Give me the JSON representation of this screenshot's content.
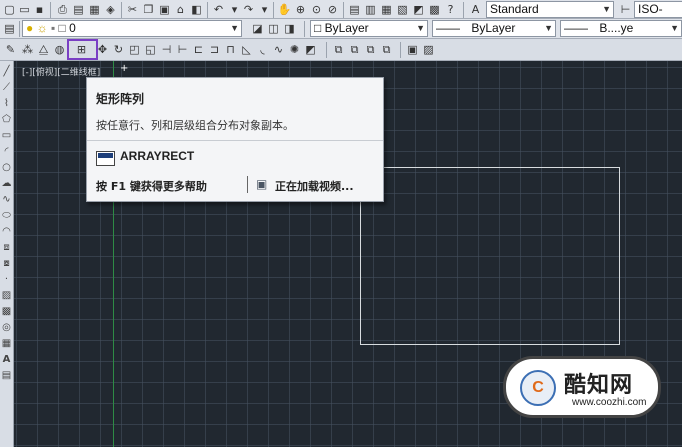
{
  "layer": {
    "current_name": "0"
  },
  "properties": {
    "color": "ByLayer",
    "linetype": "ByLayer",
    "lineweight": "B....ye"
  },
  "styles": {
    "text_style": "Standard",
    "dim_style": "ISO-"
  },
  "viewport": {
    "label": "[-][俯视][二维线框]"
  },
  "tooltip": {
    "title": "矩形阵列",
    "description": "按任意行、列和层级组合分布对象副本。",
    "command": "ARRAYRECT",
    "help_hint": "按 F1 键获得更多帮助",
    "video_status": "正在加载视频..."
  },
  "watermark": {
    "text": "酷知网",
    "url": "www.coozhi.com"
  },
  "colors": {
    "canvas": "#212830",
    "toolbar": "#dfe3ea",
    "highlight": "#7a3fc4",
    "ucs_axis": "#2e8b45"
  }
}
